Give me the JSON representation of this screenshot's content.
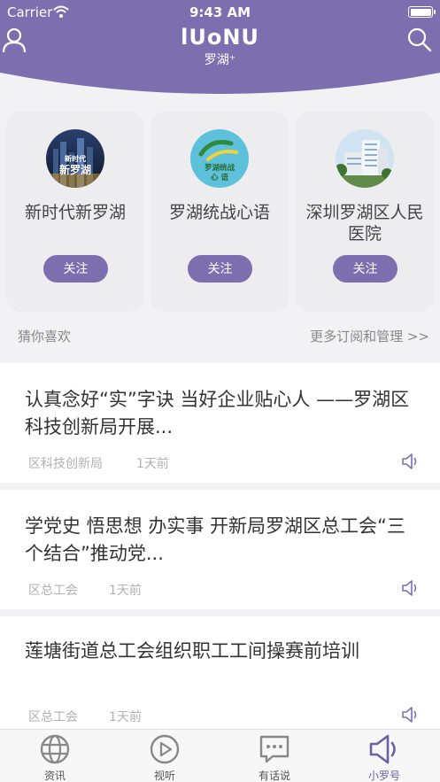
{
  "status_bar": {
    "carrier": "Carrier",
    "time": "9:43 AM"
  },
  "header": {
    "logo_mark": "lUoNU",
    "logo_sub": "罗湖⁺",
    "brand_color": "#7b6fb0"
  },
  "subscriptions": [
    {
      "name": "新时代新罗湖",
      "follow_label": "关注",
      "avatar_text": "新时代\n新罗湖"
    },
    {
      "name": "罗湖统战心语",
      "follow_label": "关注",
      "avatar_text": "罗湖统战\n心 语"
    },
    {
      "name": "深圳罗湖区人民医院",
      "follow_label": "关注"
    }
  ],
  "section": {
    "guess_label": "猜你喜欢",
    "more_label": "更多订阅和管理 >>"
  },
  "articles": [
    {
      "title": "认真念好“实”字诀 当好企业贴心人 ——罗湖区科技创新局开展...",
      "source": "区科技创新局",
      "time": "1天前"
    },
    {
      "title": "学党史 悟思想 办实事 开新局罗湖区总工会“三个结合”推动党...",
      "source": "区总工会",
      "time": "1天前"
    },
    {
      "title": "莲塘街道总工会组织职工工间操赛前培训",
      "source": "区总工会",
      "time": "1天前"
    }
  ],
  "tabs": [
    {
      "label": "资讯",
      "icon": "globe-icon"
    },
    {
      "label": "视听",
      "icon": "play-icon"
    },
    {
      "label": "有话说",
      "icon": "chat-icon"
    },
    {
      "label": "小罗号",
      "icon": "speaker-icon",
      "active": true
    }
  ]
}
